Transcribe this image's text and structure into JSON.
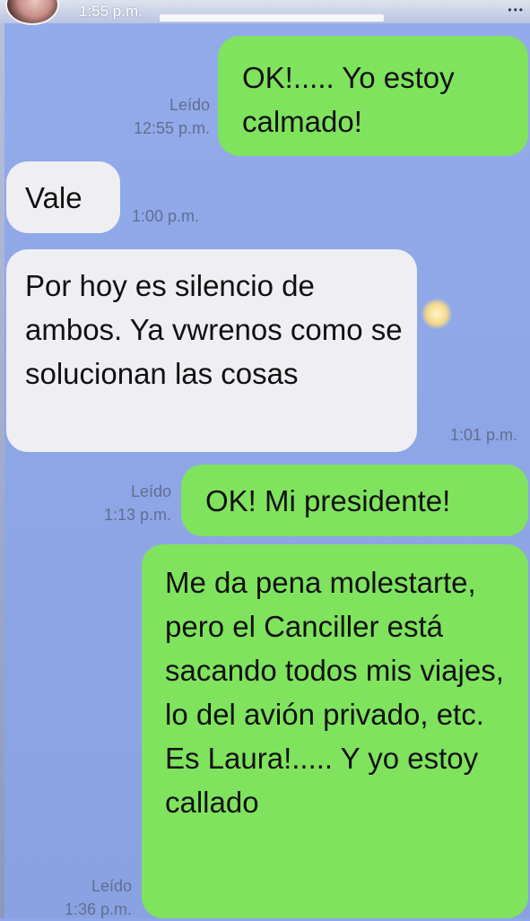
{
  "status": {
    "time": "1:55 p.m."
  },
  "messages": [
    {
      "direction": "out",
      "text": "OK!..... Yo estoy calmado!",
      "read": "Leído",
      "time": "12:55 p.m."
    },
    {
      "direction": "in",
      "text": "Vale",
      "time": "1:00 p.m."
    },
    {
      "direction": "in",
      "text": "Por hoy es silencio de ambos. Ya vwrenos como se solucionan las cosas",
      "time": "1:01 p.m."
    },
    {
      "direction": "out",
      "text": "OK! Mi presidente!",
      "read": "Leído",
      "time": "1:13 p.m."
    },
    {
      "direction": "out",
      "text": "Me da pena molestarte, pero el Canciller está sacando todos mis viajes, lo del avión privado, etc. Es Laura!..... Y yo estoy callado",
      "read": "Leído",
      "time": "1:36 p.m."
    }
  ],
  "colors": {
    "outgoing": "#7fe35e",
    "incoming": "#efeff3",
    "background": "#8fa7e8"
  }
}
